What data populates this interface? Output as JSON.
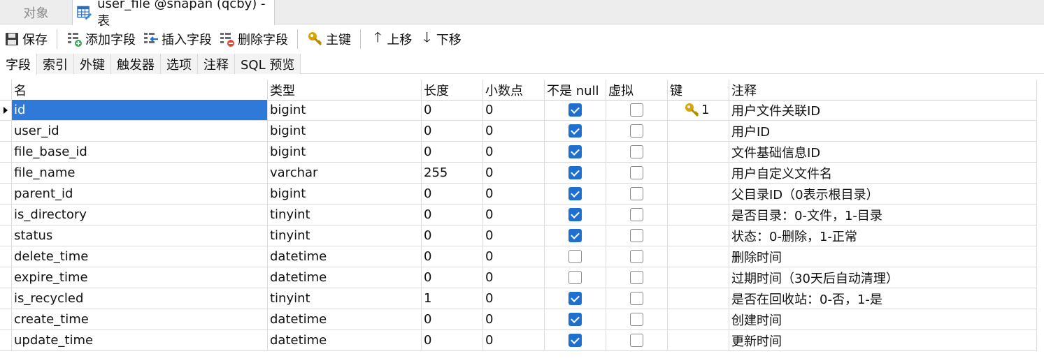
{
  "tabs": {
    "objects": "对象",
    "active": "user_file @snapan (qcby) - 表"
  },
  "toolbar": {
    "save": "保存",
    "add_field": "添加字段",
    "insert_field": "插入字段",
    "delete_field": "删除字段",
    "primary_key": "主键",
    "move_up": "上移",
    "move_down": "下移"
  },
  "subtabs": [
    "字段",
    "索引",
    "外键",
    "触发器",
    "选项",
    "注释",
    "SQL 预览"
  ],
  "columns": {
    "name": "名",
    "type": "类型",
    "length": "长度",
    "decimals": "小数点",
    "not_null": "不是 null",
    "virtual": "虚拟",
    "key": "键",
    "comment": "注释"
  },
  "colors": {
    "selection": "#2f7ad8",
    "checkbox": "#1f6fd0",
    "key": "#d9a400"
  },
  "fields": [
    {
      "name": "id",
      "type": "bigint",
      "length": "0",
      "decimals": "0",
      "not_null": true,
      "virtual": false,
      "key": "1",
      "comment": "用户文件关联ID"
    },
    {
      "name": "user_id",
      "type": "bigint",
      "length": "0",
      "decimals": "0",
      "not_null": true,
      "virtual": false,
      "key": "",
      "comment": "用户ID"
    },
    {
      "name": "file_base_id",
      "type": "bigint",
      "length": "0",
      "decimals": "0",
      "not_null": true,
      "virtual": false,
      "key": "",
      "comment": "文件基础信息ID"
    },
    {
      "name": "file_name",
      "type": "varchar",
      "length": "255",
      "decimals": "0",
      "not_null": true,
      "virtual": false,
      "key": "",
      "comment": "用户自定义文件名"
    },
    {
      "name": "parent_id",
      "type": "bigint",
      "length": "0",
      "decimals": "0",
      "not_null": true,
      "virtual": false,
      "key": "",
      "comment": "父目录ID（0表示根目录）"
    },
    {
      "name": "is_directory",
      "type": "tinyint",
      "length": "0",
      "decimals": "0",
      "not_null": true,
      "virtual": false,
      "key": "",
      "comment": "是否目录：0-文件，1-目录"
    },
    {
      "name": "status",
      "type": "tinyint",
      "length": "0",
      "decimals": "0",
      "not_null": true,
      "virtual": false,
      "key": "",
      "comment": "状态：0-删除，1-正常"
    },
    {
      "name": "delete_time",
      "type": "datetime",
      "length": "0",
      "decimals": "0",
      "not_null": false,
      "virtual": false,
      "key": "",
      "comment": "删除时间"
    },
    {
      "name": "expire_time",
      "type": "datetime",
      "length": "0",
      "decimals": "0",
      "not_null": false,
      "virtual": false,
      "key": "",
      "comment": "过期时间（30天后自动清理）"
    },
    {
      "name": "is_recycled",
      "type": "tinyint",
      "length": "1",
      "decimals": "0",
      "not_null": true,
      "virtual": false,
      "key": "",
      "comment": "是否在回收站：0-否，1-是"
    },
    {
      "name": "create_time",
      "type": "datetime",
      "length": "0",
      "decimals": "0",
      "not_null": true,
      "virtual": false,
      "key": "",
      "comment": "创建时间"
    },
    {
      "name": "update_time",
      "type": "datetime",
      "length": "0",
      "decimals": "0",
      "not_null": true,
      "virtual": false,
      "key": "",
      "comment": "更新时间"
    }
  ]
}
